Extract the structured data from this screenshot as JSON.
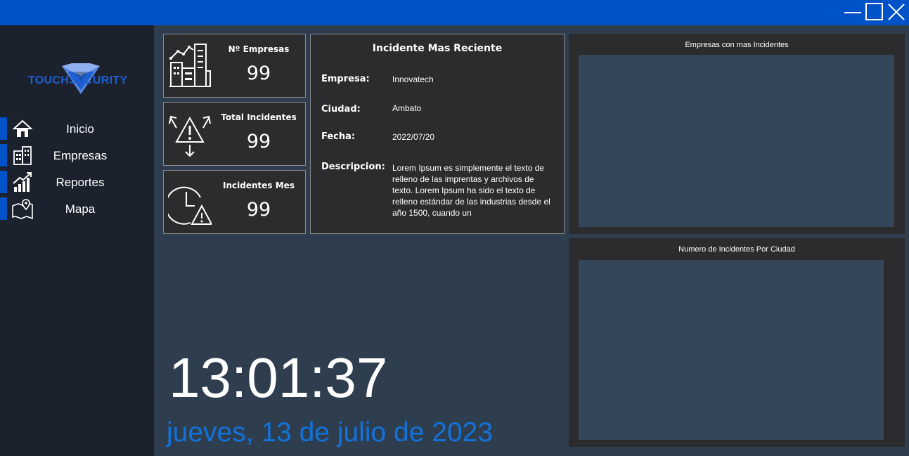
{
  "window": {
    "controls": [
      {
        "name": "minimize-button",
        "icon": "minimize-icon"
      },
      {
        "name": "maximize-button",
        "icon": "maximize-icon"
      },
      {
        "name": "close-button",
        "icon": "close-icon"
      }
    ]
  },
  "brand": {
    "name": "TOUCHSECURITY",
    "logo_icon": "shield-triangle-logo"
  },
  "nav": [
    {
      "label": "Inicio",
      "icon": "home-icon"
    },
    {
      "label": "Empresas",
      "icon": "building-icon"
    },
    {
      "label": "Reportes",
      "icon": "bar-chart-icon"
    },
    {
      "label": "Mapa",
      "icon": "map-pin-icon"
    }
  ],
  "stats": [
    {
      "title": "Nº Empresas",
      "value": "99",
      "icon": "city-growth-icon"
    },
    {
      "title": "Total Incidentes",
      "value": "99",
      "icon": "warning-arrows-icon"
    },
    {
      "title": "Incidentes Mes",
      "value": "99",
      "icon": "clock-warning-icon"
    }
  ],
  "incident": {
    "title": "Incidente Mas Reciente",
    "empresa_label": "Empresa:",
    "empresa": "Innovatech",
    "ciudad_label": "Ciudad:",
    "ciudad": "Ambato",
    "fecha_label": "Fecha:",
    "fecha": "2022/07/20",
    "descripcion_label": "Descripcion:",
    "descripcion": "Lorem Ipsum es simplemente el texto de relleno de las imprentas y archivos de texto. Lorem Ipsum ha sido el texto de relleno estándar de las industrias desde el año 1500, cuando un"
  },
  "charts": {
    "top_title": "Empresas con mas Incidentes",
    "bottom_title": "Numero de Incidentes Por Ciudad"
  },
  "clock": {
    "time": "13:01:37",
    "date": "jueves, 13 de julio de 2023"
  },
  "colors": {
    "titlebar": "#0052c9",
    "sidebar": "#1b222d",
    "background": "#2f3e4f",
    "card": "#2c2c2e",
    "accent": "#0052c9",
    "date_text": "#1372d9",
    "chart_area": "#34475a"
  }
}
